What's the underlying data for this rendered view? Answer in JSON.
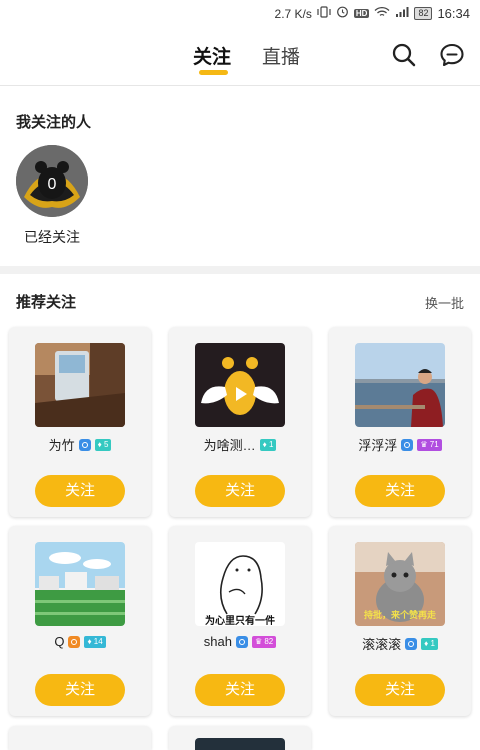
{
  "status_bar": {
    "speed": "2.7 K/s",
    "hd": "HD",
    "battery": "82",
    "time": "16:34"
  },
  "nav": {
    "tabs": [
      {
        "label": "关注"
      },
      {
        "label": "直播"
      }
    ]
  },
  "followed_section": {
    "title": "我关注的人",
    "items": [
      {
        "avatar_count": "0",
        "label": "已经关注"
      }
    ]
  },
  "recommend_section": {
    "title": "推荐关注",
    "refresh_label": "换一批"
  },
  "cards": [
    {
      "name": "为竹",
      "level": "5",
      "verify_color": "#3a8ee6",
      "level_color": "#35c9c1",
      "follow_label": "关注"
    },
    {
      "name": "为啥测…",
      "level": "1",
      "verify_color": "",
      "level_color": "#35c9c1",
      "follow_label": "关注"
    },
    {
      "name": "浮浮浮",
      "level": "71",
      "verify_color": "#3a8ee6",
      "level_color": "#b14ee0",
      "follow_label": "关注"
    },
    {
      "name": "Q",
      "level": "14",
      "verify_color": "#f08a24",
      "level_color": "#35b8d6",
      "follow_label": "关注"
    },
    {
      "name": "shah",
      "level": "82",
      "verify_color": "#3a8ee6",
      "level_color": "#d34ed9",
      "follow_label": "关注"
    },
    {
      "name": "滚滚滚",
      "level": "1",
      "verify_color": "#3a8ee6",
      "level_color": "#35c9c1",
      "follow_label": "关注"
    }
  ],
  "thumb_texts": {
    "card5": "为心里只有一件",
    "card6": "持批，来个赞再走"
  }
}
